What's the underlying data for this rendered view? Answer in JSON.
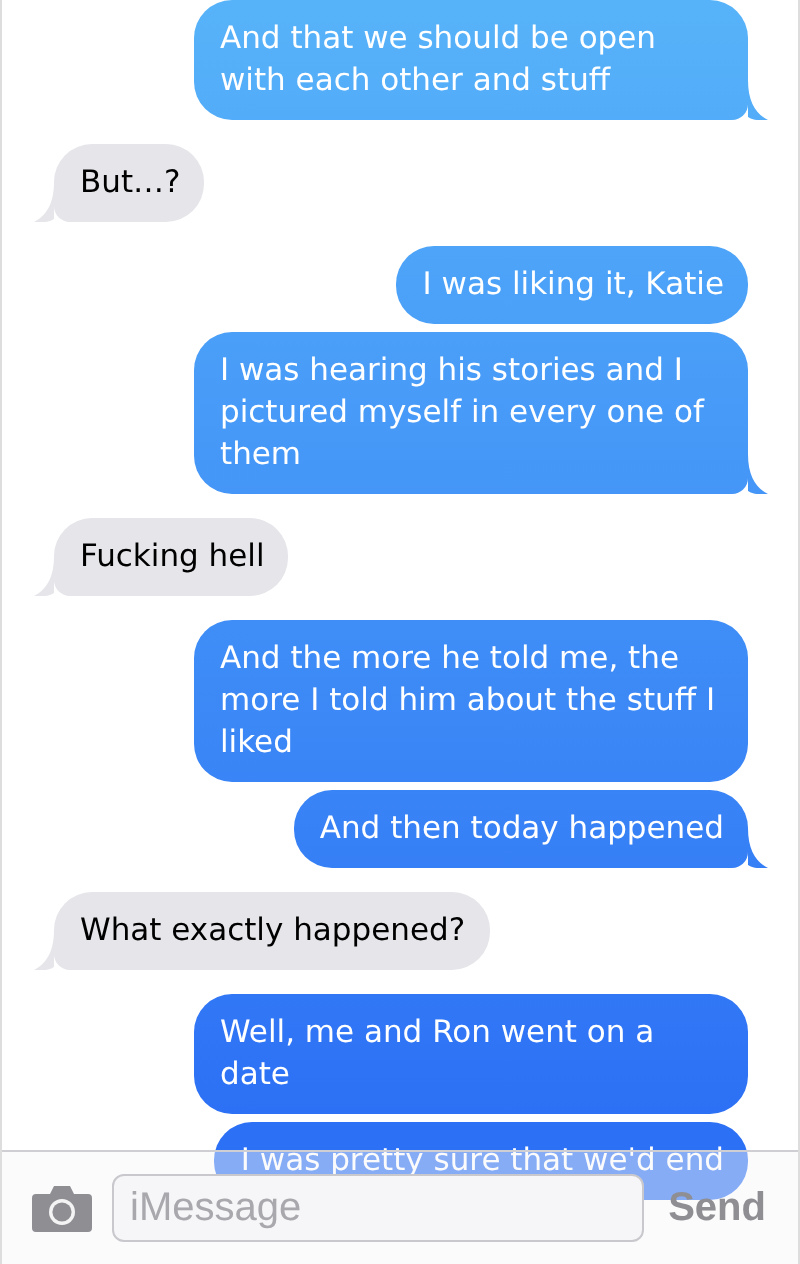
{
  "messages": [
    {
      "kind": "sent",
      "text": "And that we should be open with each other and stuff",
      "tail": true
    },
    {
      "kind": "received",
      "text": "But…?",
      "tail": true
    },
    {
      "kind": "sent",
      "text": "I was liking it, Katie",
      "tail": false
    },
    {
      "kind": "sent",
      "text": "I was hearing his stories and I pictured myself in every one of them",
      "tail": true
    },
    {
      "kind": "received",
      "text": "Fucking hell",
      "tail": true
    },
    {
      "kind": "sent",
      "text": "And the more he told me, the more I told him about the stuff I liked",
      "tail": false
    },
    {
      "kind": "sent",
      "text": "And then today happened",
      "tail": true
    },
    {
      "kind": "received",
      "text": "What exactly happened?",
      "tail": true
    },
    {
      "kind": "sent",
      "text": "Well, me and Ron went on a date",
      "tail": false
    },
    {
      "kind": "sent",
      "text": "I was pretty sure that we'd end",
      "tail": false
    }
  ],
  "composer": {
    "placeholder": "iMessage",
    "send": "Send"
  }
}
